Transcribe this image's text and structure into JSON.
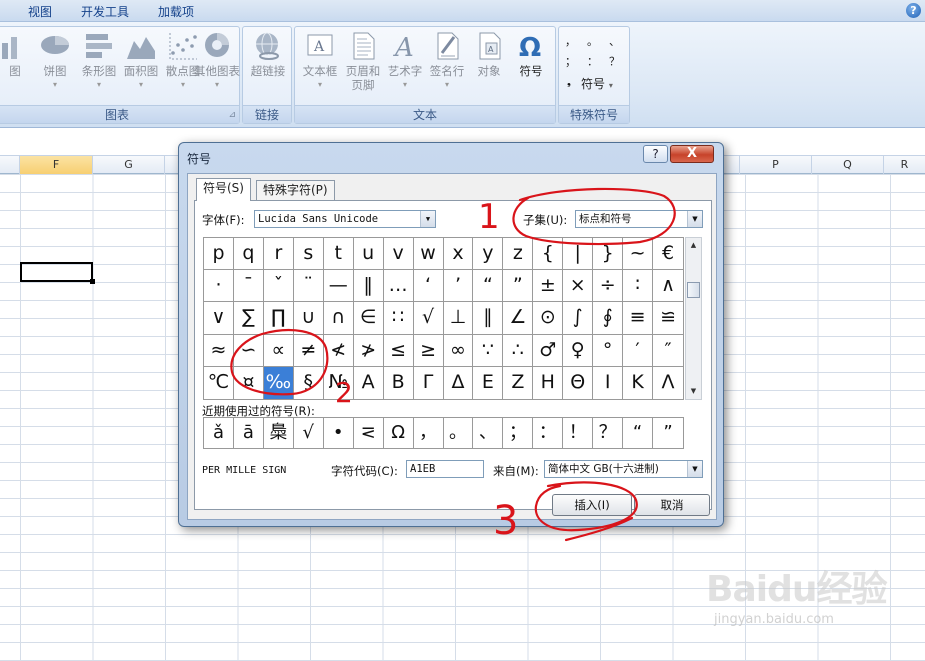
{
  "menubar": {
    "tabs": [
      "视图",
      "开发工具",
      "加载项"
    ],
    "help": "?"
  },
  "ribbon": {
    "chart_group": {
      "label": "图表",
      "buttons": [
        "图",
        "饼图",
        "条形图",
        "面积图",
        "散点图",
        "其他图表"
      ]
    },
    "link_group": {
      "label": "链接",
      "buttons": [
        "超链接"
      ]
    },
    "text_group": {
      "label": "文本",
      "buttons": [
        "文本框",
        "页眉和",
        "艺术字",
        "签名行",
        "对象",
        "符号"
      ],
      "header_footer_line2": "页脚"
    },
    "special_group": {
      "label": "特殊符号",
      "glyphs": [
        "，",
        "。",
        "、",
        "；",
        "：",
        "？",
        "♦"
      ],
      "symbol_button": "符号"
    }
  },
  "sheet": {
    "columns": [
      "F",
      "G",
      "P",
      "Q",
      "R"
    ]
  },
  "dialog": {
    "title": "符号",
    "help": "?",
    "close": "X",
    "tabs": [
      "符号(S)",
      "特殊字符(P)"
    ],
    "font_label": "字体(F):",
    "font_value": "Lucida Sans Unicode",
    "subset_label": "子集(U):",
    "subset_value": "标点和符号",
    "symbols": [
      [
        "p",
        "q",
        "r",
        "s",
        "t",
        "u",
        "v",
        "w",
        "x",
        "y",
        "z",
        "{",
        "|",
        "}",
        "~",
        "€"
      ],
      [
        "·",
        "ˉ",
        "ˇ",
        "¨",
        "—",
        "‖",
        "…",
        "‘",
        "’",
        "“",
        "”",
        "±",
        "×",
        "÷",
        "∶",
        "∧"
      ],
      [
        "∨",
        "∑",
        "∏",
        "∪",
        "∩",
        "∈",
        "∷",
        "√",
        "⊥",
        "∥",
        "∠",
        "⊙",
        "∫",
        "∮",
        "≡",
        "≌"
      ],
      [
        "≈",
        "∽",
        "∝",
        "≠",
        "≮",
        "≯",
        "≤",
        "≥",
        "∞",
        "∵",
        "∴",
        "♂",
        "♀",
        "°",
        "′",
        "″"
      ],
      [
        "℃",
        "¤",
        "‰",
        "§",
        "№",
        "Α",
        "Β",
        "Γ",
        "Δ",
        "Ε",
        "Ζ",
        "Η",
        "Θ",
        "Ι",
        "Κ",
        "Λ"
      ]
    ],
    "selected_symbol": "‰",
    "recent_label": "近期使用过的符号(R):",
    "recent": [
      "ǎ",
      "ā",
      "䲷",
      "√",
      "•",
      "⋜",
      "Ω",
      "，",
      "。",
      "、",
      "；",
      "：",
      "！",
      "？",
      "“",
      "”"
    ],
    "char_name": "PER MILLE SIGN",
    "code_label": "字符代码(C):",
    "code_value": "A1EB",
    "from_label": "来自(M):",
    "from_value": "简体中文 GB(十六进制)",
    "insert_button": "插入(I)",
    "cancel_button": "取消"
  },
  "annotations": {
    "step1": "1",
    "step2": "2",
    "step3": "3",
    "color": "#d9141a"
  },
  "watermark": {
    "logo": "Baidu经验",
    "site": "jingyan.baidu.com"
  }
}
